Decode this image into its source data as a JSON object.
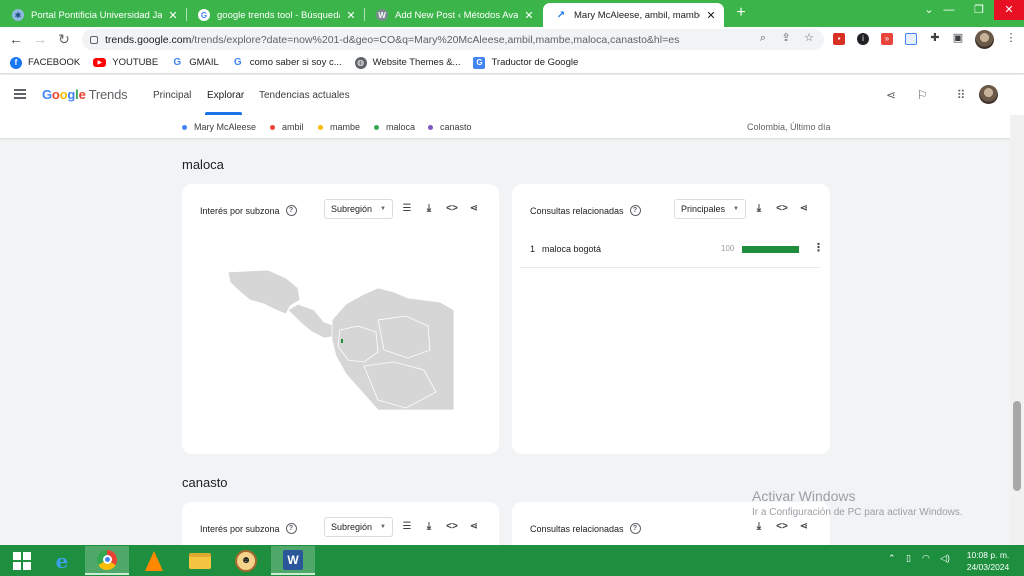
{
  "browser": {
    "tabs": [
      {
        "title": "Portal Pontificia Universidad Javeriana",
        "icon": "university-icon",
        "active": false
      },
      {
        "title": "google trends tool - Búsqueda de Google",
        "icon": "google-icon",
        "active": false
      },
      {
        "title": "Add New Post ‹ Métodos Avanzados",
        "icon": "wordpress-icon",
        "active": false
      },
      {
        "title": "Mary McAleese, ambil, mambe, maloca, canasto",
        "icon": "trends-icon",
        "active": true
      }
    ],
    "new_tab": "+",
    "url_host": "trends.google.com",
    "url_rest": "/trends/explore?date=now%201-d&geo=CO&q=Mary%20McAleese,ambil,mambe,maloca,canasto&hl=es",
    "bookmarks": [
      {
        "label": "FACEBOOK",
        "icon": "facebook-icon",
        "color": "#1877f2"
      },
      {
        "label": "YOUTUBE",
        "icon": "youtube-icon",
        "color": "#ff0000"
      },
      {
        "label": "GMAIL",
        "icon": "google-icon",
        "color": "#4285f4"
      },
      {
        "label": "como saber si soy c...",
        "icon": "google-icon",
        "color": "#4285f4"
      },
      {
        "label": "Website Themes &...",
        "icon": "globe-icon",
        "color": "#5f6368"
      },
      {
        "label": "Traductor de Google",
        "icon": "translate-icon",
        "color": "#4285f4"
      }
    ]
  },
  "header": {
    "logo_google": "Google",
    "logo_trends": "Trends",
    "nav": [
      "Principal",
      "Explorar",
      "Tendencias actuales"
    ]
  },
  "legend": {
    "terms": [
      {
        "label": "Mary McAleese",
        "color": "#4285f4"
      },
      {
        "label": "ambil",
        "color": "#ea4335"
      },
      {
        "label": "mambe",
        "color": "#fbbc04"
      },
      {
        "label": "maloca",
        "color": "#34a853"
      },
      {
        "label": "canasto",
        "color": "#7e57c2"
      }
    ],
    "scope": "Colombia, Último día"
  },
  "sections": [
    {
      "title": "maloca",
      "interest": {
        "title": "Interés por subzona",
        "dropdown": "Subregión"
      },
      "related": {
        "title": "Consultas relacionadas",
        "dropdown": "Principales",
        "rows": [
          {
            "rank": "1",
            "query": "maloca bogotá",
            "value": "100",
            "fraction": 1.0
          }
        ]
      }
    },
    {
      "title": "canasto",
      "interest": {
        "title": "Interés por subzona",
        "dropdown": "Subregión"
      },
      "related": {
        "title": "Consultas relacionadas"
      }
    }
  ],
  "watermark": {
    "line1": "Activar Windows",
    "line2": "Ir a Configuración de PC para activar Windows."
  },
  "taskbar": {
    "time": "10:08 p. m.",
    "date": "24/03/2024"
  }
}
